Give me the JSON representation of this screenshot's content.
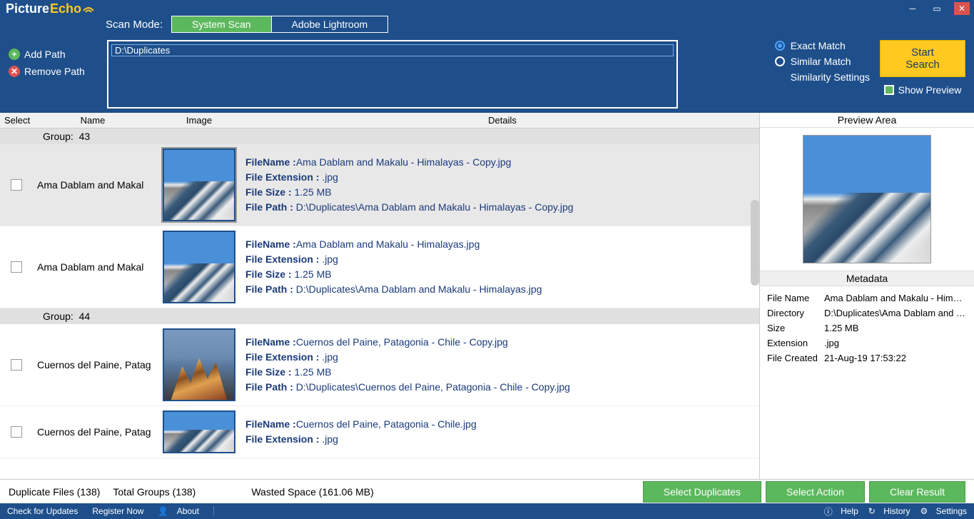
{
  "app": {
    "name_picture": "Picture",
    "name_echo": "Echo"
  },
  "scan": {
    "label": "Scan Mode:",
    "tab_system": "System Scan",
    "tab_lightroom": "Adobe Lightroom"
  },
  "path_buttons": {
    "add": "Add Path",
    "remove": "Remove Path"
  },
  "paths": {
    "entry0": "D:\\Duplicates"
  },
  "match": {
    "exact": "Exact Match",
    "similar": "Similar Match",
    "settings": "Similarity Settings"
  },
  "actions": {
    "start": "Start Search",
    "show_preview": "Show Preview"
  },
  "columns": {
    "select": "Select",
    "name": "Name",
    "image": "Image",
    "details": "Details"
  },
  "labels": {
    "group": "Group:",
    "filename": "FileName :",
    "ext": "File Extension :",
    "size": "File Size :",
    "path": "File Path  :"
  },
  "groups": {
    "g0": {
      "num": "43"
    },
    "g1": {
      "num": "44"
    }
  },
  "items": {
    "i0": {
      "name": "Ama Dablam and Makal",
      "fn": "Ama Dablam and Makalu - Himalayas - Copy.jpg",
      "ext": ".jpg",
      "size": "1.25 MB",
      "path": "D:\\Duplicates\\Ama Dablam and Makalu - Himalayas - Copy.jpg"
    },
    "i1": {
      "name": "Ama Dablam and Makal",
      "fn": "Ama Dablam and Makalu - Himalayas.jpg",
      "ext": ".jpg",
      "size": "1.25 MB",
      "path": "D:\\Duplicates\\Ama Dablam and Makalu - Himalayas.jpg"
    },
    "i2": {
      "name": "Cuernos del Paine, Patag",
      "fn": "Cuernos del Paine, Patagonia - Chile - Copy.jpg",
      "ext": ".jpg",
      "size": "1.25 MB",
      "path": "D:\\Duplicates\\Cuernos del Paine, Patagonia - Chile - Copy.jpg"
    },
    "i3": {
      "name": "Cuernos del Paine, Patag",
      "fn": "Cuernos del Paine, Patagonia - Chile.jpg",
      "ext": ".jpg"
    }
  },
  "preview": {
    "title": "Preview Area",
    "meta_title": "Metadata",
    "k_name": "File Name",
    "v_name": "Ama Dablam and Makalu - Himal...",
    "k_dir": "Directory",
    "v_dir": "D:\\Duplicates\\Ama Dablam and M...",
    "k_size": "Size",
    "v_size": "1.25 MB",
    "k_ext": "Extension",
    "v_ext": ".jpg",
    "k_created": "File Created",
    "v_created": "21-Aug-19 17:53:22"
  },
  "bottom": {
    "dup": "Duplicate Files (138)",
    "groups": "Total Groups (138)",
    "wasted": "Wasted Space (161.06 MB)",
    "sel_dup": "Select Duplicates",
    "sel_act": "Select Action",
    "clear": "Clear Result"
  },
  "status": {
    "updates": "Check for Updates",
    "register": "Register Now",
    "about": "About",
    "help": "Help",
    "history": "History",
    "settings": "Settings"
  }
}
